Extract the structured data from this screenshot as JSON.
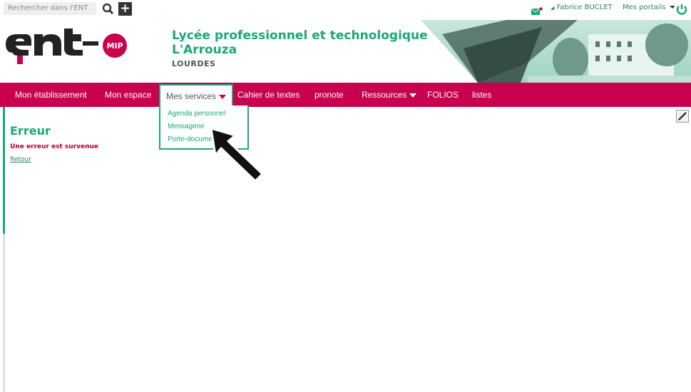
{
  "topbar": {
    "search_placeholder": "Rechercher dans l'ENT",
    "user": "Fabrice BUCLET",
    "portals": "Mes portails",
    "plus": "+"
  },
  "header": {
    "logo_text": "ent",
    "logo_badge": "MIP",
    "school_line1": "Lycée professionnel et technologique",
    "school_line2": "L'Arrouza",
    "city": "LOURDES"
  },
  "nav": {
    "items": [
      {
        "label": "Mon établissement"
      },
      {
        "label": "Mon espace"
      },
      {
        "label": "Mes services"
      },
      {
        "label": "Cahier de textes"
      },
      {
        "label": "pronote"
      },
      {
        "label": "Ressources"
      },
      {
        "label": "FOLIOS"
      },
      {
        "label": "listes"
      }
    ]
  },
  "dropdown": {
    "items": [
      "Agenda personnel",
      "Messagerie",
      "Porte-documents"
    ]
  },
  "content": {
    "title": "Erreur",
    "message": "Une erreur est survenue",
    "back": "Retour"
  },
  "colors": {
    "accent": "#c8004d",
    "green": "#1aa878"
  }
}
